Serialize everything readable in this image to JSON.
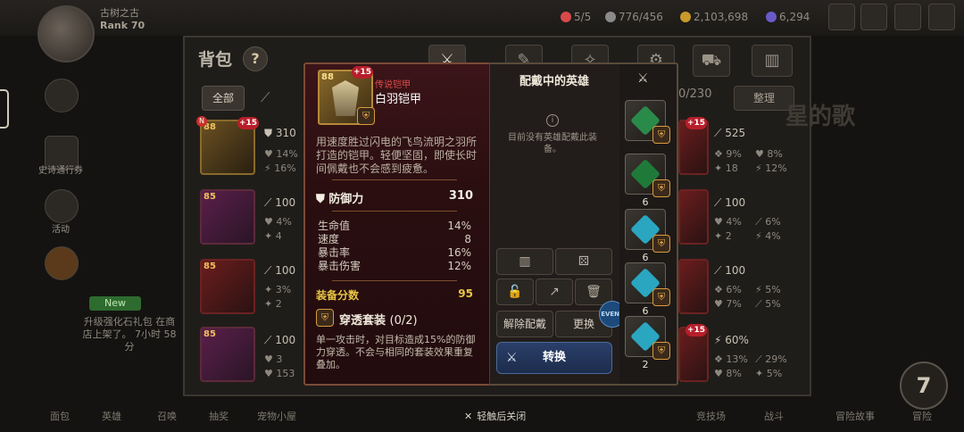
{
  "hud": {
    "player_name": "古树之古",
    "rank": "Rank 70",
    "resources": [
      "5/5",
      "776/456",
      "2,103,698",
      "6,294"
    ]
  },
  "sidebar": {
    "items": [
      "史诗通行券",
      "活动",
      "",
      "New"
    ],
    "promo": "升级强化石礼包 在商店上架了。 7小时 58分"
  },
  "bag": {
    "title": "背包",
    "help": "?",
    "filter_all": "全部",
    "count": "0/230",
    "sort": "整理",
    "bg_title": "星的歌"
  },
  "list_left": [
    {
      "level": "88",
      "plus": "+15",
      "badge": "N",
      "main": "310",
      "sub1": "14%",
      "sub2": "16%"
    },
    {
      "level": "85",
      "main": "100",
      "sub1": "4%",
      "sub2": "4"
    },
    {
      "level": "85",
      "main": "100",
      "sub1": "3%",
      "sub2": "2"
    },
    {
      "level": "85",
      "main": "100",
      "sub1": "3",
      "sub2": "153"
    }
  ],
  "list_right": [
    {
      "plus": "+15",
      "main": "525",
      "sub1a": "9%",
      "sub1b": "8%",
      "sub2a": "18",
      "sub2b": "12%"
    },
    {
      "main": "100",
      "sub1a": "4%",
      "sub1b": "6%",
      "sub2a": "2",
      "sub2b": "4%"
    },
    {
      "main": "100",
      "sub1a": "6%",
      "sub1b": "5%",
      "sub2a": "7%",
      "sub2b": "5%"
    },
    {
      "plus": "+15",
      "main": "60%",
      "sub1a": "13%",
      "sub1b": "29%",
      "sub2a": "8%",
      "sub2b": "5%"
    }
  ],
  "bottom_nav": [
    "面包",
    "英雄",
    "召唤",
    "抽奖",
    "宠物小屋",
    "",
    "竞技场",
    "战斗",
    "冒险故事",
    "冒险"
  ],
  "close_hint": "轻触后关闭",
  "seven_badge": "7",
  "detail": {
    "level": "88",
    "plus": "+15",
    "rarity": "传说铠甲",
    "name": "白羽铠甲",
    "description": "用速度胜过闪电的飞鸟流明之羽所打造的铠甲。轻便坚固，即使长时间佩戴也不会感到疲惫。",
    "main_stat_label": "防御力",
    "main_stat_value": "310",
    "substats": [
      {
        "label": "生命值",
        "value": "14%"
      },
      {
        "label": "速度",
        "value": "8"
      },
      {
        "label": "暴击率",
        "value": "16%"
      },
      {
        "label": "暴击伤害",
        "value": "12%"
      }
    ],
    "score_label": "装备分数",
    "score_value": "95",
    "set_name": "穿透套装",
    "set_count": "(0/2)",
    "set_description": "单一攻击时，对目标造成15%的防御力穿透。不会与相同的套装效果重复叠加。"
  },
  "equipped": {
    "title": "配戴中的英雄",
    "info": "i",
    "note": "目前没有英雄配戴此装备。",
    "unequip": "解除配戴",
    "change": "更换",
    "convert": "转换",
    "event": "EVENT"
  },
  "artifacts": [
    {
      "count": "",
      "color": "#2a8a4a"
    },
    {
      "count": "6",
      "color": "#1f7a3a"
    },
    {
      "count": "6",
      "color": "#2aa6c0"
    },
    {
      "count": "6",
      "color": "#2aa6c0"
    },
    {
      "count": "2",
      "color": "#2aa6c0"
    }
  ],
  "colors": {
    "accent_gold": "#e8c545",
    "legend_red": "#e04b4b",
    "convert_blue": "#2a3f6a"
  }
}
